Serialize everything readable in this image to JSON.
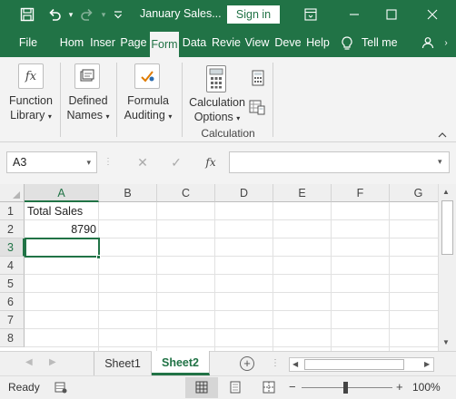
{
  "titlebar": {
    "title": "January Sales...",
    "signin_label": "Sign in",
    "icons": [
      "save-icon",
      "undo-icon",
      "redo-icon",
      "customize-icon",
      "ribbon-display-icon",
      "minimize-icon",
      "maximize-icon",
      "close-icon"
    ]
  },
  "tabs": [
    "File",
    "Hom",
    "Inser",
    "Page",
    "Form",
    "Data",
    "Revie",
    "View",
    "Deve",
    "Help",
    "Tell me"
  ],
  "active_tab": "Form",
  "ribbon": {
    "function_library": [
      "Function",
      "Library"
    ],
    "defined_names": [
      "Defined",
      "Names"
    ],
    "formula_auditing": [
      "Formula",
      "Auditing"
    ],
    "calculation_options": [
      "Calculation",
      "Options"
    ],
    "group_label": "Calculation",
    "fx_glyph": "fx"
  },
  "formula_bar": {
    "name_box": "A3",
    "formula_value": "",
    "fx_label": "fx"
  },
  "columns": [
    "A",
    "B",
    "C",
    "D",
    "E",
    "F",
    "G"
  ],
  "rows": [
    "1",
    "2",
    "3",
    "4",
    "5",
    "6",
    "7",
    "8"
  ],
  "cells": {
    "A1": "Total Sales",
    "A2": "8790"
  },
  "selected_cell": "A3",
  "sheets": [
    "Sheet1",
    "Sheet2"
  ],
  "active_sheet": "Sheet2",
  "status": {
    "ready": "Ready",
    "zoom": "100%",
    "zoom_minus": "−",
    "zoom_plus": "+"
  },
  "colors": {
    "accent": "#217346",
    "selection": "#217346"
  }
}
